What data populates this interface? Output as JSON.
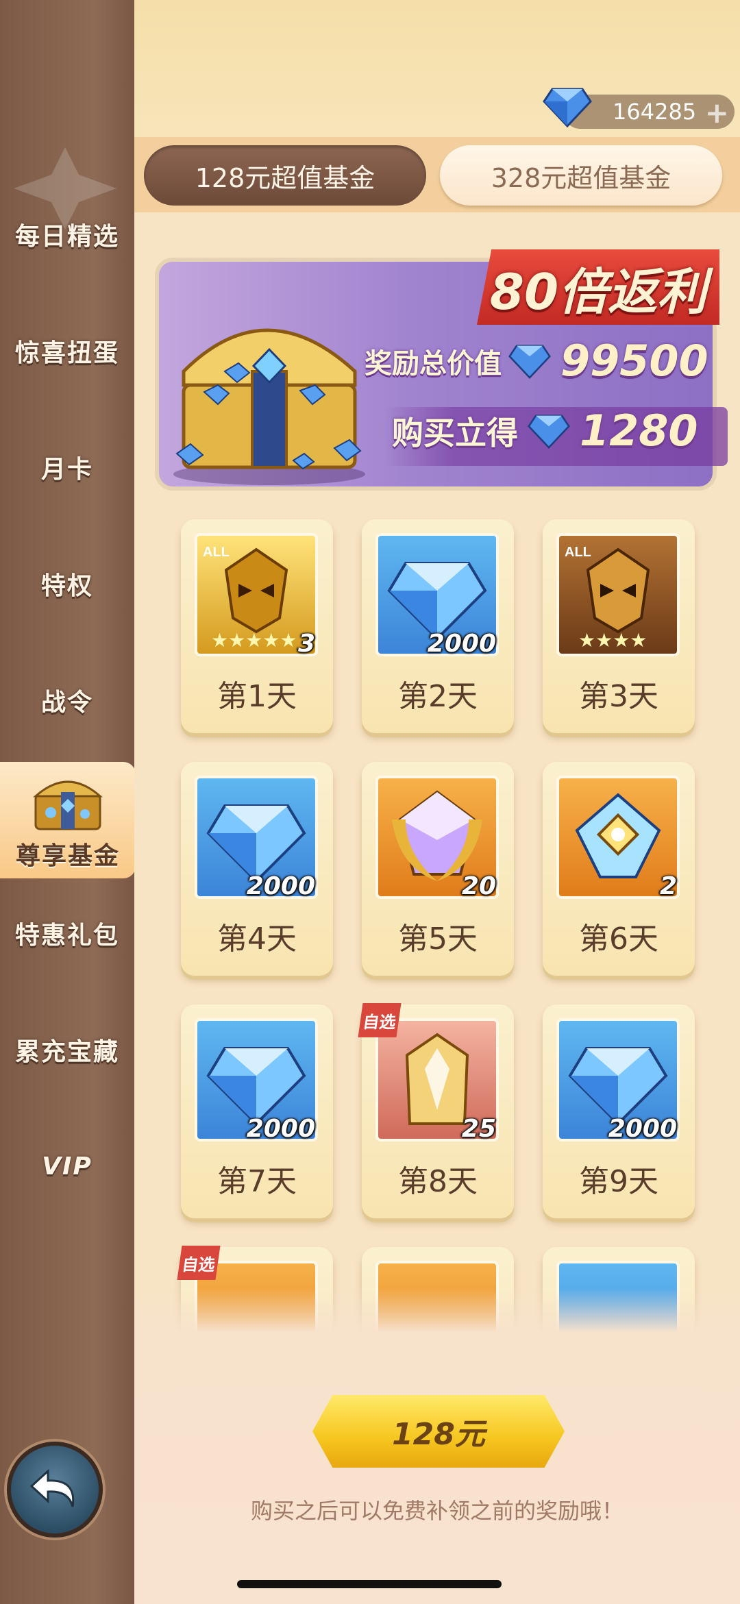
{
  "sidebar": {
    "items": [
      {
        "label": "每日精选"
      },
      {
        "label": "惊喜扭蛋"
      },
      {
        "label": "月卡"
      },
      {
        "label": "特权"
      },
      {
        "label": "战令"
      },
      {
        "label": "尊享基金"
      },
      {
        "label": "特惠礼包"
      },
      {
        "label": "累充宝藏"
      },
      {
        "label": "VIP"
      }
    ],
    "active_index": 5
  },
  "currency": {
    "value": "164285",
    "icon": "diamond-icon"
  },
  "tabs": [
    {
      "label": "128元超值基金",
      "selected": true
    },
    {
      "label": "328元超值基金",
      "selected": false
    }
  ],
  "banner": {
    "ribbon": "80倍返利",
    "total_label": "奖励总价值",
    "total_value": "99500",
    "instant_label": "购买立得",
    "instant_value": "1280"
  },
  "rewards": [
    {
      "day": "第1天",
      "count": "3",
      "item": "gold-mask-icon"
    },
    {
      "day": "第2天",
      "count": "2000",
      "item": "diamond-icon"
    },
    {
      "day": "第3天",
      "count": "",
      "item": "bronze-mask-icon"
    },
    {
      "day": "第4天",
      "count": "2000",
      "item": "diamond-icon"
    },
    {
      "day": "第5天",
      "count": "20",
      "item": "crystal-gem-icon"
    },
    {
      "day": "第6天",
      "count": "2",
      "item": "crystal-ring-icon"
    },
    {
      "day": "第7天",
      "count": "2000",
      "item": "diamond-icon"
    },
    {
      "day": "第8天",
      "count": "25",
      "item": "armor-icon",
      "tag": "自选"
    },
    {
      "day": "第9天",
      "count": "2000",
      "item": "diamond-icon"
    }
  ],
  "partial_row_tag": "自选",
  "buy_button": {
    "label": "128元"
  },
  "footer_note": "购买之后可以免费补领之前的奖励哦！",
  "colors": {
    "accent": "#f6c61f",
    "ribbon": "#d8352c",
    "sidebar": "#8e6b55"
  }
}
